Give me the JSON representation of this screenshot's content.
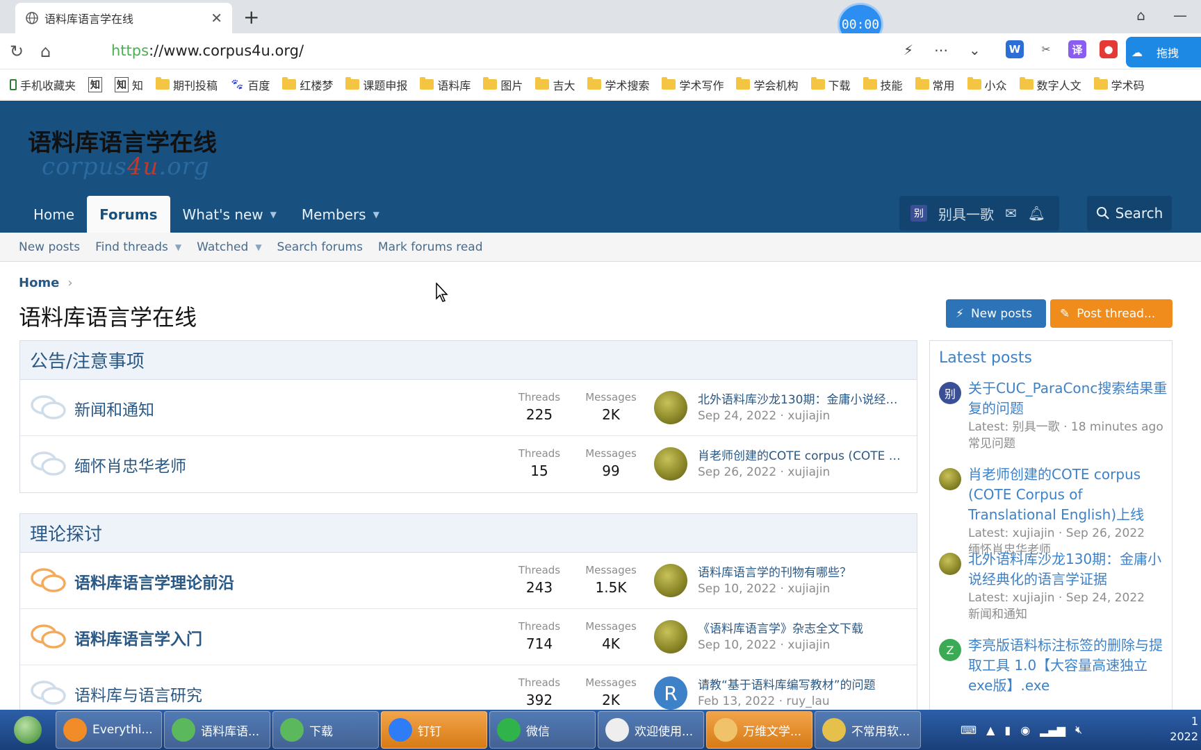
{
  "browser": {
    "tab_title": "语料库语言学在线",
    "tab_close": "✕",
    "new_tab": "+",
    "timer": "00:00",
    "url_proto": "https",
    "url_rest": "://www.corpus4u.org/",
    "cloud_label": "拖拽",
    "ext_w": "W",
    "ext_t": "译",
    "bookmarks": [
      "手机收藏夹",
      "知",
      "知",
      "期刊投稿",
      "百度",
      "红楼梦",
      "课题申报",
      "语料库",
      "图片",
      "吉大",
      "学术搜索",
      "学术写作",
      "学会机构",
      "下载",
      "技能",
      "常用",
      "小众",
      "数字人文",
      "学术码"
    ]
  },
  "site": {
    "logo_title": "语料库语言学在线",
    "logo_sub_1": "corpus",
    "logo_sub_hl": "4u",
    "logo_sub_2": ".org",
    "nav": {
      "home": "Home",
      "forums": "Forums",
      "whats_new": "What's new",
      "members": "Members"
    },
    "user_avatar": "别",
    "username": "别具一歌",
    "search": "Search",
    "subnav": {
      "new_posts": "New posts",
      "find_threads": "Find threads",
      "watched": "Watched",
      "search_forums": "Search forums",
      "mark_read": "Mark forums read"
    }
  },
  "page": {
    "breadcrumb_home": "Home",
    "breadcrumb_sep": "›",
    "title": "语料库语言学在线",
    "btn_new_posts": "New posts",
    "btn_post_thread": "Post thread..."
  },
  "stat_labels": {
    "threads": "Threads",
    "messages": "Messages"
  },
  "categories": [
    {
      "title": "公告/注意事项",
      "nodes": [
        {
          "title": "新闻和通知",
          "threads": "225",
          "messages": "2K",
          "last_title": "北外语料库沙龙130期：金庸小说经典化的语言学证据",
          "last_meta": "Sep 24, 2022 · xujiajin",
          "avatar": "potato"
        },
        {
          "title": "缅怀肖忠华老师",
          "threads": "15",
          "messages": "99",
          "last_title": "肖老师创建的COTE corpus (COTE Corpus of Translational English)上线",
          "last_meta": "Sep 26, 2022 · xujiajin",
          "avatar": "potato"
        }
      ]
    },
    {
      "title": "理论探讨",
      "nodes": [
        {
          "title": "语料库语言学理论前沿",
          "threads": "243",
          "messages": "1.5K",
          "last_title": "语料库语言学的刊物有哪些？",
          "last_meta": "Sep 10, 2022 · xujiajin",
          "avatar": "potato"
        },
        {
          "title": "语料库语言学入门",
          "threads": "714",
          "messages": "4K",
          "last_title": "《语料库语言学》杂志全文下载",
          "last_meta": "Sep 10, 2022 · xujiajin",
          "avatar": "potato"
        },
        {
          "title": "语料库与语言研究",
          "threads": "392",
          "messages": "2K",
          "last_title": "请教“基于语料库编写教材”的问题",
          "last_meta": "Feb 13, 2022 · ruy_lau",
          "avatar": "R"
        }
      ]
    }
  ],
  "sidebar": {
    "heading": "Latest posts",
    "items": [
      {
        "title": "关于CUC_ParaConc搜索结果重复的问题",
        "meta1": "Latest: 别具一歌 · 18 minutes ago",
        "meta2": "常见问题",
        "avatar": "别",
        "color": "#3a4f95"
      },
      {
        "title": "肖老师创建的COTE corpus (COTE Corpus of Translational English)上线",
        "meta1": "Latest: xujiajin · Sep 26, 2022",
        "meta2": "缅怀肖忠华老师",
        "avatar": "",
        "color": "potato"
      },
      {
        "title": "北外语料库沙龙130期：金庸小说经典化的语言学证据",
        "meta1": "Latest: xujiajin · Sep 24, 2022",
        "meta2": "新闻和通知",
        "avatar": "",
        "color": "potato"
      },
      {
        "title": "李亮版语料标注标签的删除与提取工具 1.0【大容量高速独立exe版】.exe",
        "meta1": "",
        "meta2": "",
        "avatar": "Z",
        "color": "#3aaa55"
      }
    ]
  },
  "taskbar": {
    "items": [
      "Everythi...",
      "语料库语...",
      "下载",
      "钉钉",
      "微信",
      "欢迎使用...",
      "万维文学...",
      "不常用软..."
    ],
    "clock_time": "1",
    "clock_date": "2022"
  }
}
